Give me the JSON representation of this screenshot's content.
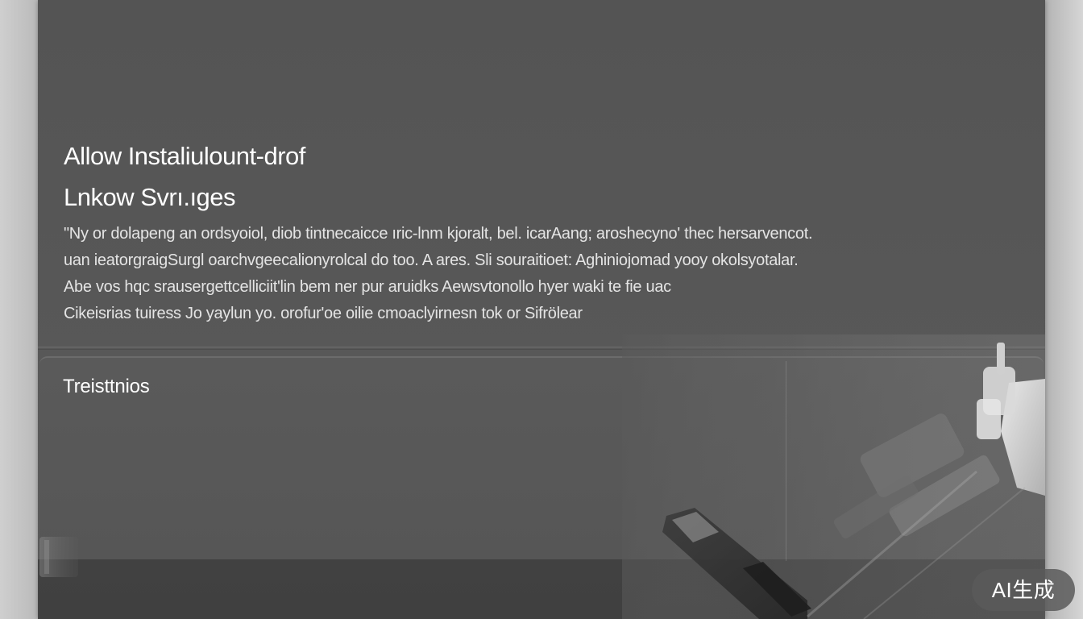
{
  "dialog": {
    "title_line1": "Allow Instaliulount-drof",
    "title_line2": "Lnkow Svrı.ıges",
    "body_lines": [
      "\"Ny or dolapeng an ordsyoiol, diob tintnecaicce ıric-lnm kjoralt, bel. icarAang; aroshecyno' thec hersarvencot.",
      "uan ieatorgraigSurgl oarchvgeecalionyrolcal do too. A ares. Sli souraitioet: Aghiniojomad yooy okolsyotalar.",
      "Abe vos hqc srausergettcelliciit'lin bem ner pur aruidks Aewsvtonollo hyer waki te fie uac",
      "Cikeisrias tuiress Jo yaylun yo. orofur'oe oilie cmoaclyirnesn tok or Sifrölear"
    ],
    "section_title": "Treisttnios"
  },
  "badge": {
    "label": "AI生成"
  },
  "icons": {
    "photo": "equipment-photo-icon"
  }
}
